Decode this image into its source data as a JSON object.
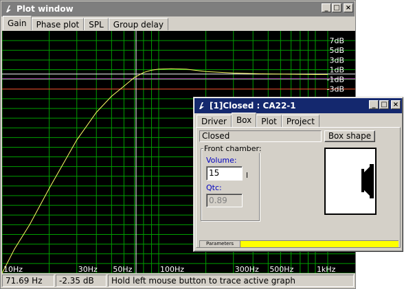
{
  "plot_window": {
    "title": "Plot window",
    "tabs": [
      "Gain",
      "Phase plot",
      "SPL",
      "Group delay"
    ],
    "selected_tab": "Gain",
    "status": {
      "frequency": "71.69 Hz",
      "gain": "-2.35 dB",
      "hint": "Hold left mouse button to trace active graph"
    }
  },
  "chart_data": {
    "type": "line",
    "x_scale": "log",
    "xlim": [
      10,
      1200
    ],
    "ylim": [
      -41,
      9
    ],
    "grid": true,
    "x_tick_labels": [
      "10Hz",
      "30Hz",
      "50Hz",
      "100Hz",
      "300Hz",
      "500Hz",
      "1kHz"
    ],
    "x_tick_values": [
      10,
      30,
      50,
      100,
      300,
      500,
      1000
    ],
    "y_tick_labels": [
      "7dB",
      "5dB",
      "3dB",
      "1dB",
      "-1dB",
      "-3dB"
    ],
    "y_tick_values": [
      7,
      5,
      3,
      1,
      -1,
      -3
    ],
    "series": [
      {
        "color": "#ffff66",
        "x": [
          10,
          12,
          15,
          20,
          25,
          30,
          40,
          50,
          60,
          70,
          80,
          90,
          100,
          120,
          150,
          200,
          300,
          500,
          1000,
          1200
        ],
        "y": [
          -41,
          -36,
          -31,
          -23.5,
          -18,
          -13.5,
          -7.8,
          -4.5,
          -2.4,
          -0.6,
          0.4,
          0.9,
          1.1,
          1.2,
          1.1,
          0.6,
          0.3,
          0.1,
          0.0,
          0.0
        ]
      }
    ],
    "reference_lines": [
      {
        "y": -3,
        "color": "#ff3030"
      },
      {
        "y": -0.9,
        "color": "#ff60ff"
      },
      {
        "y": 0.1,
        "color": "#ffffff"
      }
    ],
    "cursor_x": 71.69,
    "colors": {
      "background": "#000000",
      "grid": "#00a000"
    }
  },
  "closed_window": {
    "title": "[1]Closed : CA22-1",
    "tabs": [
      "Driver",
      "Box",
      "Plot",
      "Project"
    ],
    "selected_tab": "Box",
    "box_type": "Closed",
    "box_shape_button": "Box shape",
    "group_label": "Front chamber:",
    "volume_label": "Volume:",
    "volume_value": "15",
    "volume_unit": "l",
    "qtc_label": "Qtc:",
    "qtc_value": "0.89",
    "params_label": "Parameters",
    "accent_color": "#ffff00",
    "label_color": "#0000c0"
  },
  "title_buttons": [
    "_",
    "□",
    "×"
  ]
}
